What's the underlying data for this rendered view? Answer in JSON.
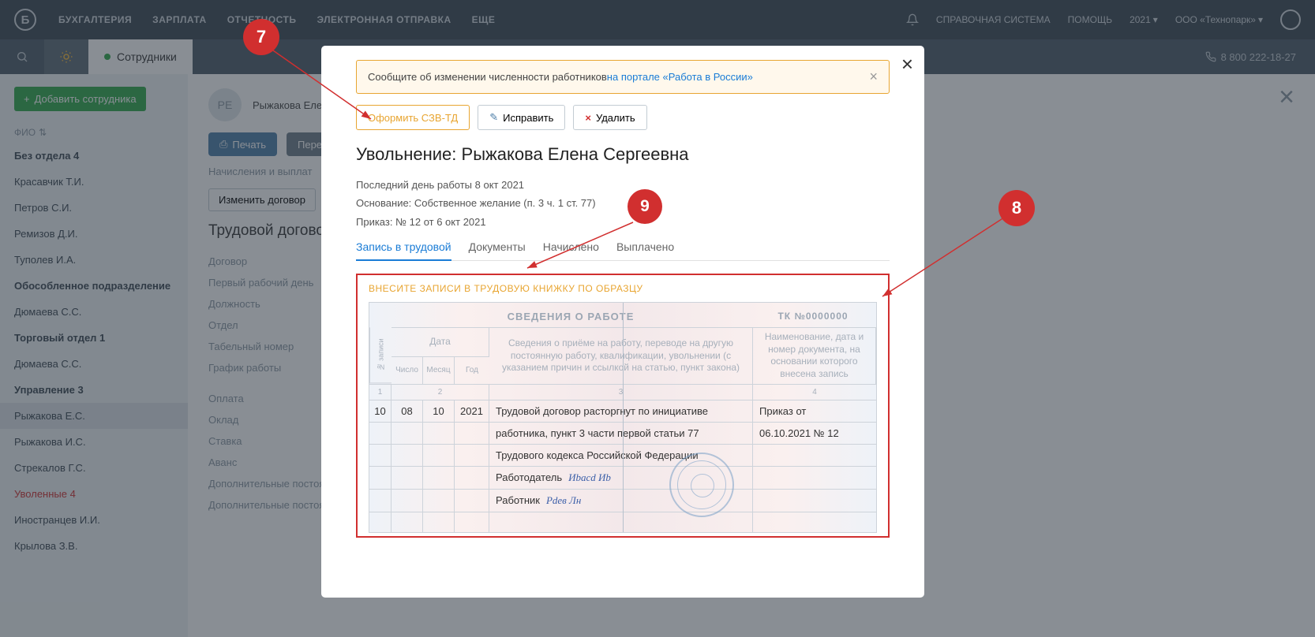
{
  "header": {
    "nav": [
      "БУХГАЛТЕРИЯ",
      "ЗАРПЛАТА",
      "ОТЧЕТНОСТЬ",
      "ЭЛЕКТРОННАЯ ОТПРАВКА",
      "ЕЩЕ"
    ],
    "right": {
      "help_system": "СПРАВОЧНАЯ СИСТЕМА",
      "help": "ПОМОЩЬ",
      "year": "2021",
      "org": "ООО «Технопарк»"
    }
  },
  "subheader": {
    "tab": "Сотрудники",
    "phone": "8 800 222-18-27"
  },
  "sidebar": {
    "add_label": "Добавить сотрудника",
    "fio_label": "ФИО",
    "items": [
      {
        "label": "Без отдела 4",
        "bold": true
      },
      {
        "label": "Красавчик Т.И."
      },
      {
        "label": "Петров С.И."
      },
      {
        "label": "Ремизов Д.И."
      },
      {
        "label": "Туполев И.А."
      },
      {
        "label": "Обособленное подразделение",
        "bold": true
      },
      {
        "label": "Дюмаева С.С."
      },
      {
        "label": "Торговый отдел 1",
        "bold": true
      },
      {
        "label": "Дюмаева С.С."
      },
      {
        "label": "Управление 3",
        "bold": true
      },
      {
        "label": "Рыжакова Е.С.",
        "selected": true
      },
      {
        "label": "Рыжакова И.С."
      },
      {
        "label": "Стрекалов Г.С."
      },
      {
        "label": "Уволенные 4",
        "fired": true
      },
      {
        "label": "Иностранцев И.И."
      },
      {
        "label": "Крылова З.В."
      }
    ]
  },
  "main": {
    "avatar_initials": "РЕ",
    "employee_name": "Рыжакова Еле",
    "btn_print": "Печать",
    "btn_recalc": "Перера",
    "tabs_line": "Начисления и выплат",
    "change_contract": "Изменить договор",
    "section_title": "Трудовой догово",
    "fields": [
      "Договор",
      "Первый рабочий день",
      "Должность",
      "Отдел",
      "Табельный номер",
      "График работы",
      "",
      "Оплата",
      "Оклад",
      "Ставка",
      "Аванс",
      "Дополнительные постоя\nначисления",
      "Дополнительные постоя\nудержания"
    ]
  },
  "modal": {
    "warning_text": "Сообщите об изменении численности работников ",
    "warning_link": "на портале «Работа в России»",
    "btn_szv": "Оформить СЗВ-ТД",
    "btn_edit": "Исправить",
    "btn_delete": "Удалить",
    "title": "Увольнение: Рыжакова Елена Сергеевна",
    "last_day": "Последний день работы 8 окт 2021",
    "reason": "Основание: Собственное желание (п. 3 ч. 1 ст. 77)",
    "order": "Приказ: № 12 от 6 окт 2021",
    "tabs": [
      "Запись в трудовой",
      "Документы",
      "Начислено",
      "Выплачено"
    ],
    "workbook": {
      "instruction": "ВНЕСИТЕ ЗАПИСИ В ТРУДОВУЮ КНИЖКУ ПО ОБРАЗЦУ",
      "center_title": "СВЕДЕНИЯ О РАБОТЕ",
      "tk_number": "ТК №0000000",
      "col_no_vert": "№ записи",
      "col_date": "Дата",
      "col_day": "Число",
      "col_month": "Месяц",
      "col_year": "Год",
      "col_info": "Сведения о приёме на работу, переводе на другую постоянную работу, квалификации, увольнении (с указанием причин и ссылкой на статью, пункт закона)",
      "col_doc": "Наименование, дата и номер документа, на основании которого внесена запись",
      "col_nums": [
        "1",
        "2",
        "3",
        "4"
      ],
      "row": {
        "no": "10",
        "day": "08",
        "month": "10",
        "year": "2021",
        "text1": "Трудовой договор расторгнут по инициативе",
        "text2": "работника, пункт 3 части первой статьи 77",
        "text3": "Трудового кодекса Российской Федерации",
        "doc1": "Приказ от",
        "doc2": "06.10.2021 № 12",
        "employer_label": "Работодатель",
        "employee_label": "Работник"
      }
    }
  },
  "annotations": {
    "n7": "7",
    "n8": "8",
    "n9": "9"
  }
}
